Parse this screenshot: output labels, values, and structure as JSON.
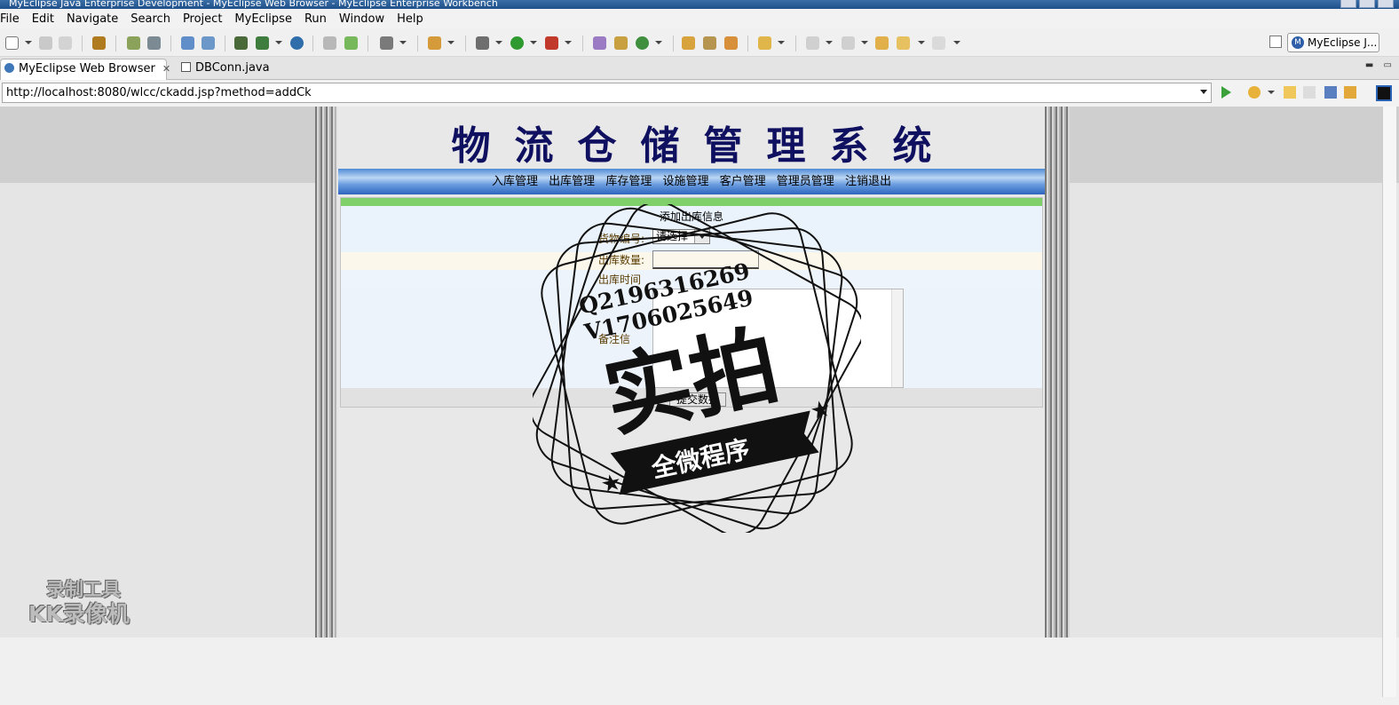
{
  "window": {
    "title": "MyEclipse Java Enterprise Development - MyEclipse Web Browser - MyEclipse Enterprise Workbench"
  },
  "menu": [
    "File",
    "Edit",
    "Navigate",
    "Search",
    "Project",
    "MyEclipse",
    "Run",
    "Window",
    "Help"
  ],
  "perspective": {
    "label": "MyEclipse J..."
  },
  "tabs": [
    {
      "label": "MyEclipse Web Browser",
      "active": true
    },
    {
      "label": "DBConn.java",
      "active": false
    }
  ],
  "address": {
    "url": "http://localhost:8080/wlcc/ckadd.jsp?method=addCk"
  },
  "site": {
    "title": "物流仓储管理系统",
    "nav": [
      "入库管理",
      "出库管理",
      "库存管理",
      "设施管理",
      "客户管理",
      "管理员管理",
      "注销退出"
    ]
  },
  "form": {
    "title": "添加出库信息",
    "goods_label": "货物编号:",
    "goods_value": "请选择",
    "qty_label": "出库数量:",
    "time_label": "出库时间",
    "remark_label": "备注信",
    "submit_label": "提交数据"
  },
  "watermark": {
    "qq": "Q2196316269",
    "wechat": "V1706025649",
    "big": "实拍",
    "ribbon": "全微程序",
    "recorder_line1": "录制工具",
    "recorder_line2": "KK录像机"
  },
  "colors": {
    "title_text": "#101060",
    "nav_blue": "#4f8bd6",
    "form_green": "#7fd06a",
    "go_green": "#3aa13a"
  }
}
